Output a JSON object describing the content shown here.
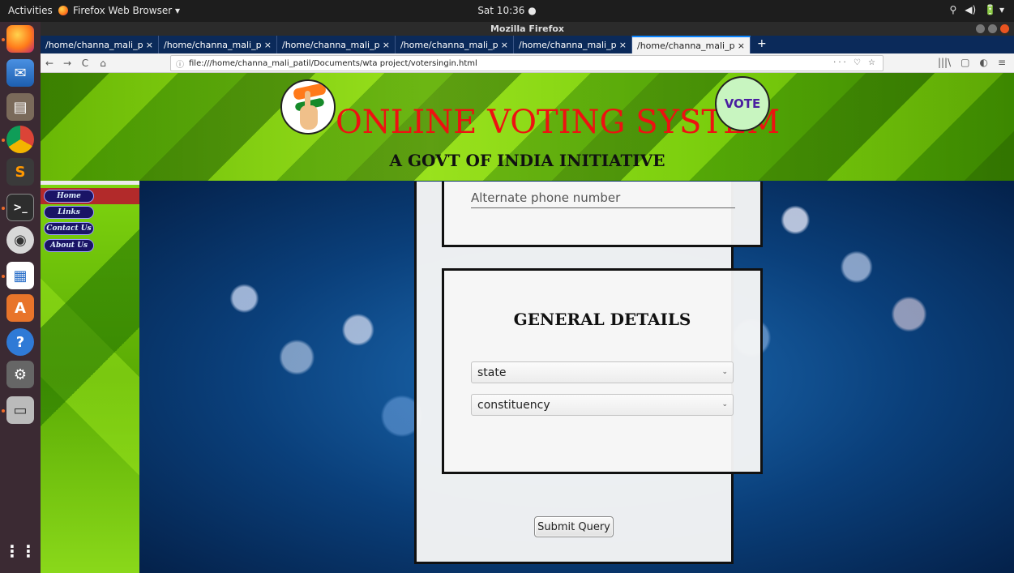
{
  "system": {
    "activities": "Activities",
    "app_menu": "Firefox Web Browser ▾",
    "clock": "Sat 10:36 ●",
    "tray": [
      "⚲",
      "◀)",
      "🔋 ▾"
    ]
  },
  "window": {
    "title": "Mozilla Firefox"
  },
  "tabs": [
    {
      "label": "/home/channa_mali_patil/D"
    },
    {
      "label": "/home/channa_mali_patil/D"
    },
    {
      "label": "/home/channa_mali_patil/D"
    },
    {
      "label": "/home/channa_mali_patil/D"
    },
    {
      "label": "/home/channa_mali_patil/D"
    },
    {
      "label": "/home/channa_mali_patil/D"
    }
  ],
  "tab_close": "×",
  "new_tab": "+",
  "nav": {
    "back": "←",
    "forward": "→",
    "reload": "C",
    "home": "⌂",
    "url": "file:///home/channa_mali_patil/Documents/wta project/votersingin.html",
    "url_info": "ⓘ",
    "url_right": "··· ♡ ☆",
    "right_buttons": [
      "|||\\",
      "▢",
      "◐",
      "≡"
    ]
  },
  "site": {
    "title": "ONLINE VOTING SYSTEM",
    "subtitle": "A GOVT OF INDIA INITIATIVE",
    "vote_badge": "VOTE"
  },
  "menu": {
    "home": "Home",
    "links": "Links",
    "contact": "Contact Us",
    "about": "About Us"
  },
  "form": {
    "alt_phone_placeholder": "Alternate phone number",
    "general_title": "GENERAL DETAILS",
    "state": "state",
    "constituency": "constituency",
    "chevron": "⌄",
    "submit": "Submit Query"
  },
  "dock_icons": [
    "firefox-icon",
    "thunderbird-icon",
    "files-icon",
    "chrome-icon",
    "sublime-icon",
    "terminal-icon",
    "audio-icon",
    "writer-icon",
    "software-icon",
    "help-icon",
    "settings-icon",
    "scanner-icon",
    "apps-grid-icon"
  ]
}
